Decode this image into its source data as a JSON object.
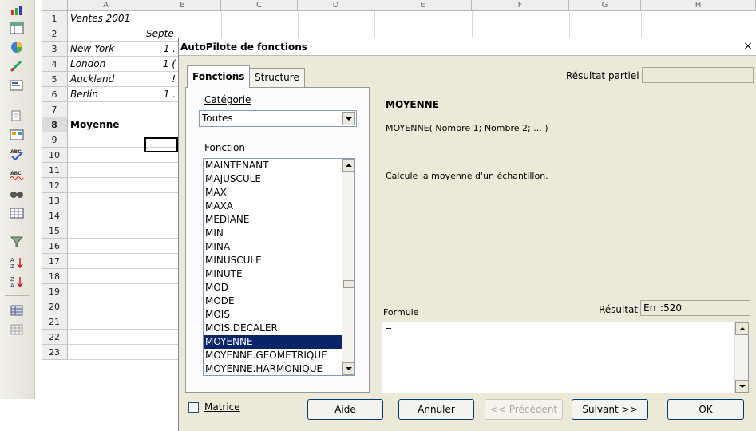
{
  "spreadsheet": {
    "columns": [
      "A",
      "B",
      "C",
      "D",
      "E",
      "F",
      "G",
      "H"
    ],
    "rows": [
      {
        "num": "1",
        "a": "Ventes 2001",
        "b": ""
      },
      {
        "num": "2",
        "a": "",
        "b": "Septe"
      },
      {
        "num": "3",
        "a": "New York",
        "b": "1 ."
      },
      {
        "num": "4",
        "a": "London",
        "b": "1 ("
      },
      {
        "num": "5",
        "a": "Auckland",
        "b": "!"
      },
      {
        "num": "6",
        "a": "Berlin",
        "b": "1 ."
      },
      {
        "num": "7",
        "a": "",
        "b": ""
      },
      {
        "num": "8",
        "a": "Moyenne",
        "b": ""
      },
      {
        "num": "9",
        "a": "",
        "b": ""
      },
      {
        "num": "10",
        "a": "",
        "b": ""
      },
      {
        "num": "11",
        "a": "",
        "b": ""
      },
      {
        "num": "12",
        "a": "",
        "b": ""
      },
      {
        "num": "13",
        "a": "",
        "b": ""
      },
      {
        "num": "14",
        "a": "",
        "b": ""
      },
      {
        "num": "15",
        "a": "",
        "b": ""
      },
      {
        "num": "16",
        "a": "",
        "b": ""
      },
      {
        "num": "17",
        "a": "",
        "b": ""
      },
      {
        "num": "18",
        "a": "",
        "b": ""
      },
      {
        "num": "19",
        "a": "",
        "b": ""
      },
      {
        "num": "20",
        "a": "",
        "b": ""
      },
      {
        "num": "21",
        "a": "",
        "b": ""
      },
      {
        "num": "22",
        "a": "",
        "b": ""
      },
      {
        "num": "23",
        "a": "",
        "b": ""
      }
    ],
    "selected_row": "8"
  },
  "dialog": {
    "title": "AutoPilote de fonctions",
    "close_glyph": "×",
    "tabs": [
      "Fonctions",
      "Structure"
    ],
    "active_tab": "Fonctions",
    "category_label": "Catégorie",
    "category_value": "Toutes",
    "function_label": "Fonction",
    "functions": [
      "MAINTENANT",
      "MAJUSCULE",
      "MAX",
      "MAXA",
      "MEDIANE",
      "MIN",
      "MINA",
      "MINUSCULE",
      "MINUTE",
      "MOD",
      "MODE",
      "MOIS",
      "MOIS.DECALER",
      "MOYENNE",
      "MOYENNE.GEOMETRIQUE",
      "MOYENNE.HARMONIQUE"
    ],
    "selected_function": "MOYENNE",
    "partial_result_label": "Résultat partiel",
    "partial_result_value": "",
    "function_name": "MOYENNE",
    "function_syntax": "MOYENNE( Nombre 1; Nombre 2; ... )",
    "function_description": "Calcule la moyenne d'un échantillon.",
    "formula_label": "Formule",
    "formula_value": "=",
    "result_label": "Résultat",
    "result_value": "Err :520",
    "array_checkbox_label": "Matrice",
    "array_checked": false,
    "buttons": {
      "help": "Aide",
      "cancel": "Annuler",
      "previous": "<< Précédent",
      "next": "Suivant >>",
      "ok": "OK"
    }
  },
  "toolbar_icons": [
    "insert-chart-icon",
    "data-pilot-icon",
    "pie-chart-icon",
    "draw-functions-icon",
    "insert-object-icon",
    "spelling-icon",
    "navigator-icon",
    "spellcheck-icon",
    "autospellcheck-icon",
    "find-replace-icon",
    "gallery-icon",
    "filter-icon",
    "sort-ascending-icon",
    "sort-descending-icon",
    "data-sources-icon",
    "table-grid-icon"
  ]
}
